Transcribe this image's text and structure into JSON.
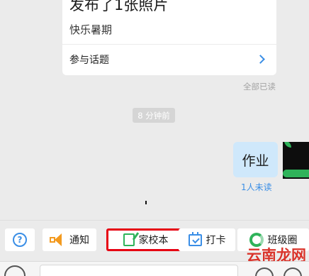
{
  "card": {
    "title": "发布了1张照片",
    "subtitle": "快乐暑期",
    "topic_label": "参与话题"
  },
  "read_status": "全部已读",
  "time_divider": "8 分钟前",
  "bubble": {
    "text": "作业",
    "unread": "1人未读"
  },
  "toolbar": {
    "help_glyph": "?",
    "notify_label": "通知",
    "homeschool_label": "家校本",
    "checkin_label": "打卡",
    "class_circle_label": "班级圈"
  },
  "watermark": "云南龙网",
  "input": {
    "placeholder": ""
  },
  "colors": {
    "accent": "#3a8ee6",
    "highlight_border": "#e60012",
    "green": "#2fb35a",
    "orange": "#f39a1f"
  }
}
